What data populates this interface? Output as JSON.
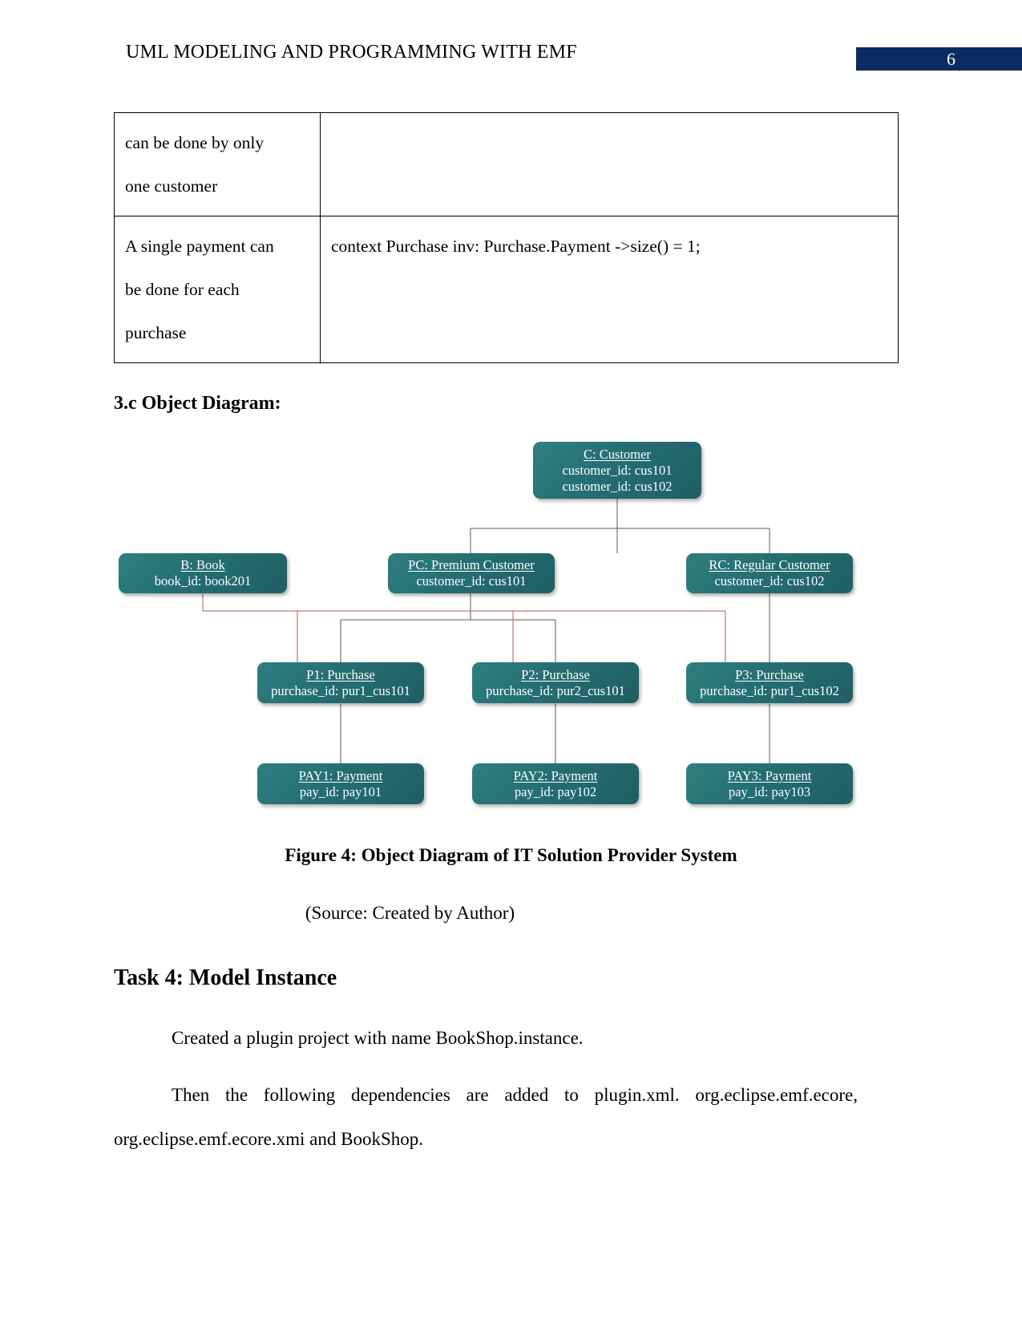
{
  "header": {
    "title": "UML MODELING AND PROGRAMMING WITH EMF",
    "page_number": "6",
    "page_number_bg": "#0d2b63"
  },
  "table": {
    "rows": [
      {
        "left_lines": [
          "can be done by only",
          "one customer"
        ],
        "right_lines": []
      },
      {
        "left_lines": [
          "A single payment can",
          "be done for each",
          "purchase"
        ],
        "right_lines": [
          "context Purchase inv: Purchase.Payment ->size() = 1;"
        ]
      }
    ]
  },
  "section": {
    "heading": "3.c Object Diagram:"
  },
  "diagram": {
    "node_fill": "#246e72",
    "link_color_gray": "#595959",
    "link_color_red": "#b05a5a",
    "nodes": [
      {
        "id": "customer",
        "title": "C: Customer",
        "attrs": [
          "customer_id: cus101",
          "customer_id: cus102"
        ]
      },
      {
        "id": "book",
        "title": "B: Book",
        "attrs": [
          "book_id: book201"
        ]
      },
      {
        "id": "premium-customer",
        "title": "PC: Premium Customer",
        "attrs": [
          "customer_id: cus101"
        ]
      },
      {
        "id": "regular-customer",
        "title": "RC: Regular Customer",
        "attrs": [
          "customer_id: cus102"
        ]
      },
      {
        "id": "purchase-1",
        "title": "P1: Purchase",
        "attrs": [
          "purchase_id: pur1_cus101"
        ]
      },
      {
        "id": "purchase-2",
        "title": "P2: Purchase",
        "attrs": [
          "purchase_id: pur2_cus101"
        ]
      },
      {
        "id": "purchase-3",
        "title": "P3: Purchase",
        "attrs": [
          "purchase_id: pur1_cus102"
        ]
      },
      {
        "id": "payment-1",
        "title": "PAY1: Payment",
        "attrs": [
          "pay_id: pay101"
        ]
      },
      {
        "id": "payment-2",
        "title": "PAY2: Payment",
        "attrs": [
          "pay_id: pay102"
        ]
      },
      {
        "id": "payment-3",
        "title": "PAY3: Payment",
        "attrs": [
          "pay_id: pay103"
        ]
      }
    ]
  },
  "figure": {
    "caption": "Figure 4: Object Diagram of IT Solution Provider System",
    "source": "(Source: Created by Author)"
  },
  "task": {
    "heading": "Task 4: Model Instance",
    "paragraph_1": "Created a plugin project with name BookShop.instance.",
    "paragraph_2": "Then the following dependencies are added to plugin.xml. org.eclipse.emf.ecore, org.eclipse.emf.ecore.xmi and BookShop."
  }
}
